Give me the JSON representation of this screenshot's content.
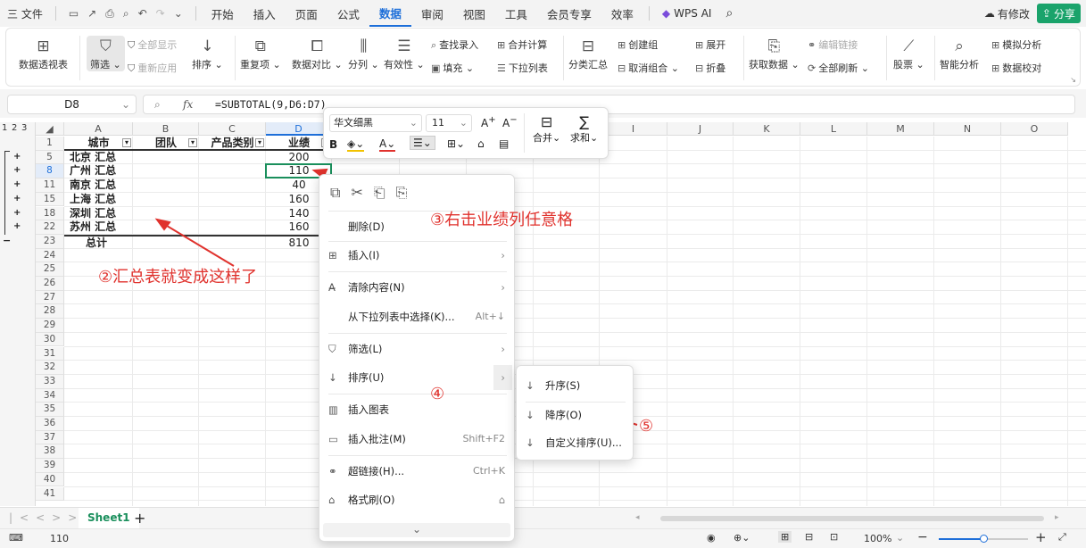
{
  "menubar": {
    "file": "三 文件",
    "tabs": [
      "开始",
      "插入",
      "页面",
      "公式",
      "数据",
      "审阅",
      "视图",
      "工具",
      "会员专享",
      "效率"
    ],
    "active_tab": "数据",
    "wps_ai": "WPS AI",
    "modified": "有修改",
    "share": "分享"
  },
  "ribbon": {
    "pivot": "数据透视表",
    "filter": "筛选",
    "show_all": "全部显示",
    "reapply": "重新应用",
    "sort": "排序",
    "duplicates": "重复项",
    "compare": "数据对比",
    "split": "分列",
    "validity": "有效性",
    "find_entry": "查找录入",
    "fill": "填充",
    "merge_calc": "合并计算",
    "dropdown": "下拉列表",
    "subtotal": "分类汇总",
    "create_group": "创建组",
    "ungroup": "取消组合",
    "expand": "展开",
    "collapse": "折叠",
    "get_data": "获取数据",
    "edit_links": "编辑链接",
    "refresh_all": "全部刷新",
    "stocks": "股票",
    "smart_analysis": "智能分析",
    "simulate": "模拟分析",
    "data_check": "数据校对"
  },
  "formula_bar": {
    "name_box": "D8",
    "formula": "=SUBTOTAL(9,D6:D7)"
  },
  "grid": {
    "columns": [
      "A",
      "B",
      "C",
      "D",
      "E",
      "F",
      "G",
      "H",
      "I",
      "J",
      "K",
      "L",
      "M",
      "N",
      "O"
    ],
    "outline_levels": [
      "1",
      "2",
      "3"
    ],
    "rows": [
      {
        "num": "1",
        "a": "城市",
        "b": "团队",
        "c": "产品类别",
        "d": "业绩"
      },
      {
        "num": "5",
        "a": "北京 汇总",
        "b": "",
        "c": "",
        "d": "200"
      },
      {
        "num": "8",
        "a": "广州 汇总",
        "b": "",
        "c": "",
        "d": "110"
      },
      {
        "num": "11",
        "a": "南京 汇总",
        "b": "",
        "c": "",
        "d": "40"
      },
      {
        "num": "15",
        "a": "上海 汇总",
        "b": "",
        "c": "",
        "d": "160"
      },
      {
        "num": "18",
        "a": "深圳 汇总",
        "b": "",
        "c": "",
        "d": "140"
      },
      {
        "num": "22",
        "a": "苏州 汇总",
        "b": "",
        "c": "",
        "d": "160"
      },
      {
        "num": "23",
        "a": "总计",
        "b": "",
        "c": "",
        "d": "810"
      },
      {
        "num": "24"
      },
      {
        "num": "25"
      },
      {
        "num": "26"
      },
      {
        "num": "27"
      },
      {
        "num": "28"
      },
      {
        "num": "29"
      },
      {
        "num": "30"
      },
      {
        "num": "31"
      },
      {
        "num": "32"
      },
      {
        "num": "33"
      },
      {
        "num": "34"
      },
      {
        "num": "35"
      },
      {
        "num": "36"
      },
      {
        "num": "37"
      },
      {
        "num": "38"
      },
      {
        "num": "39"
      },
      {
        "num": "40"
      },
      {
        "num": "41"
      }
    ]
  },
  "mini_toolbar": {
    "font": "华文细黑",
    "size": "11",
    "merge": "合并",
    "sum": "求和"
  },
  "context_menu": {
    "delete": "删除(D)",
    "insert": "插入(I)",
    "clear": "清除内容(N)",
    "pick_list": "从下拉列表中选择(K)...",
    "pick_list_sc": "Alt+↓",
    "filter": "筛选(L)",
    "sort": "排序(U)",
    "insert_chart": "插入图表",
    "insert_comment": "插入批注(M)",
    "insert_comment_sc": "Shift+F2",
    "hyperlink": "超链接(H)...",
    "hyperlink_sc": "Ctrl+K",
    "format_painter": "格式刷(O)"
  },
  "sort_submenu": {
    "asc": "升序(S)",
    "desc": "降序(O)",
    "custom": "自定义排序(U)..."
  },
  "annotations": {
    "a2": "②汇总表就变成这样了",
    "a3": "③右击业绩列任意格",
    "a4": "④",
    "a5": "⑤"
  },
  "sheets": {
    "active": "Sheet1"
  },
  "status": {
    "value": "110",
    "zoom": "100%"
  },
  "colors": {
    "accent": "#1e6fd9",
    "annotation": "#e0322d",
    "share": "#1aa36b"
  }
}
